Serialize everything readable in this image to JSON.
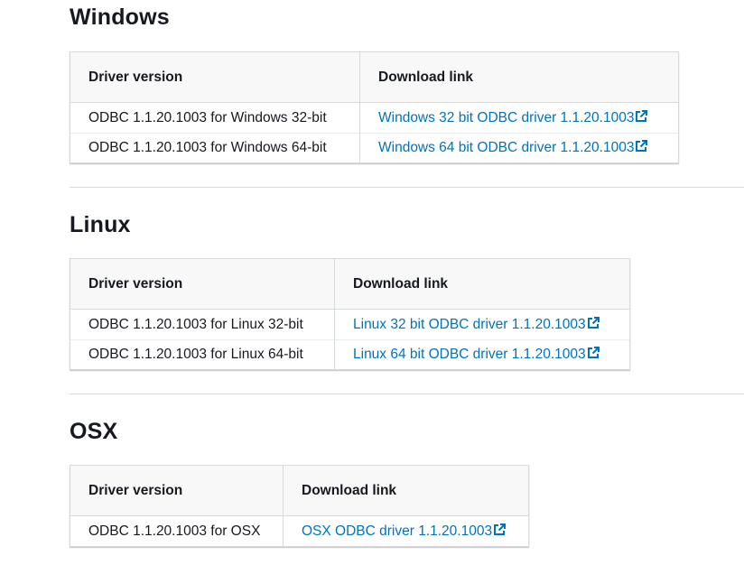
{
  "sections": [
    {
      "title": "Windows",
      "header_version": "Driver version",
      "header_link": "Download link",
      "rows": [
        {
          "version": "ODBC 1.1.20.1003 for Windows 32-bit",
          "link": "Windows 32 bit ODBC driver 1.1.20.1003"
        },
        {
          "version": "ODBC 1.1.20.1003 for Windows 64-bit",
          "link": "Windows 64 bit ODBC driver 1.1.20.1003"
        }
      ]
    },
    {
      "title": "Linux",
      "header_version": "Driver version",
      "header_link": "Download link",
      "rows": [
        {
          "version": "ODBC 1.1.20.1003 for Linux 32-bit",
          "link": "Linux 32 bit ODBC driver 1.1.20.1003"
        },
        {
          "version": "ODBC 1.1.20.1003 for Linux 64-bit",
          "link": "Linux 64 bit ODBC driver 1.1.20.1003"
        }
      ]
    },
    {
      "title": "OSX",
      "header_version": "Driver version",
      "header_link": "Download link",
      "rows": [
        {
          "version": "ODBC 1.1.20.1003 for OSX",
          "link": "OSX ODBC driver 1.1.20.1003"
        }
      ]
    }
  ],
  "icons": {
    "link_icon": "external-link-icon"
  },
  "colors": {
    "link": "#0073bb",
    "heading": "#16191f",
    "header_bg": "#f8f8f8",
    "border": "#d5dbdb"
  }
}
